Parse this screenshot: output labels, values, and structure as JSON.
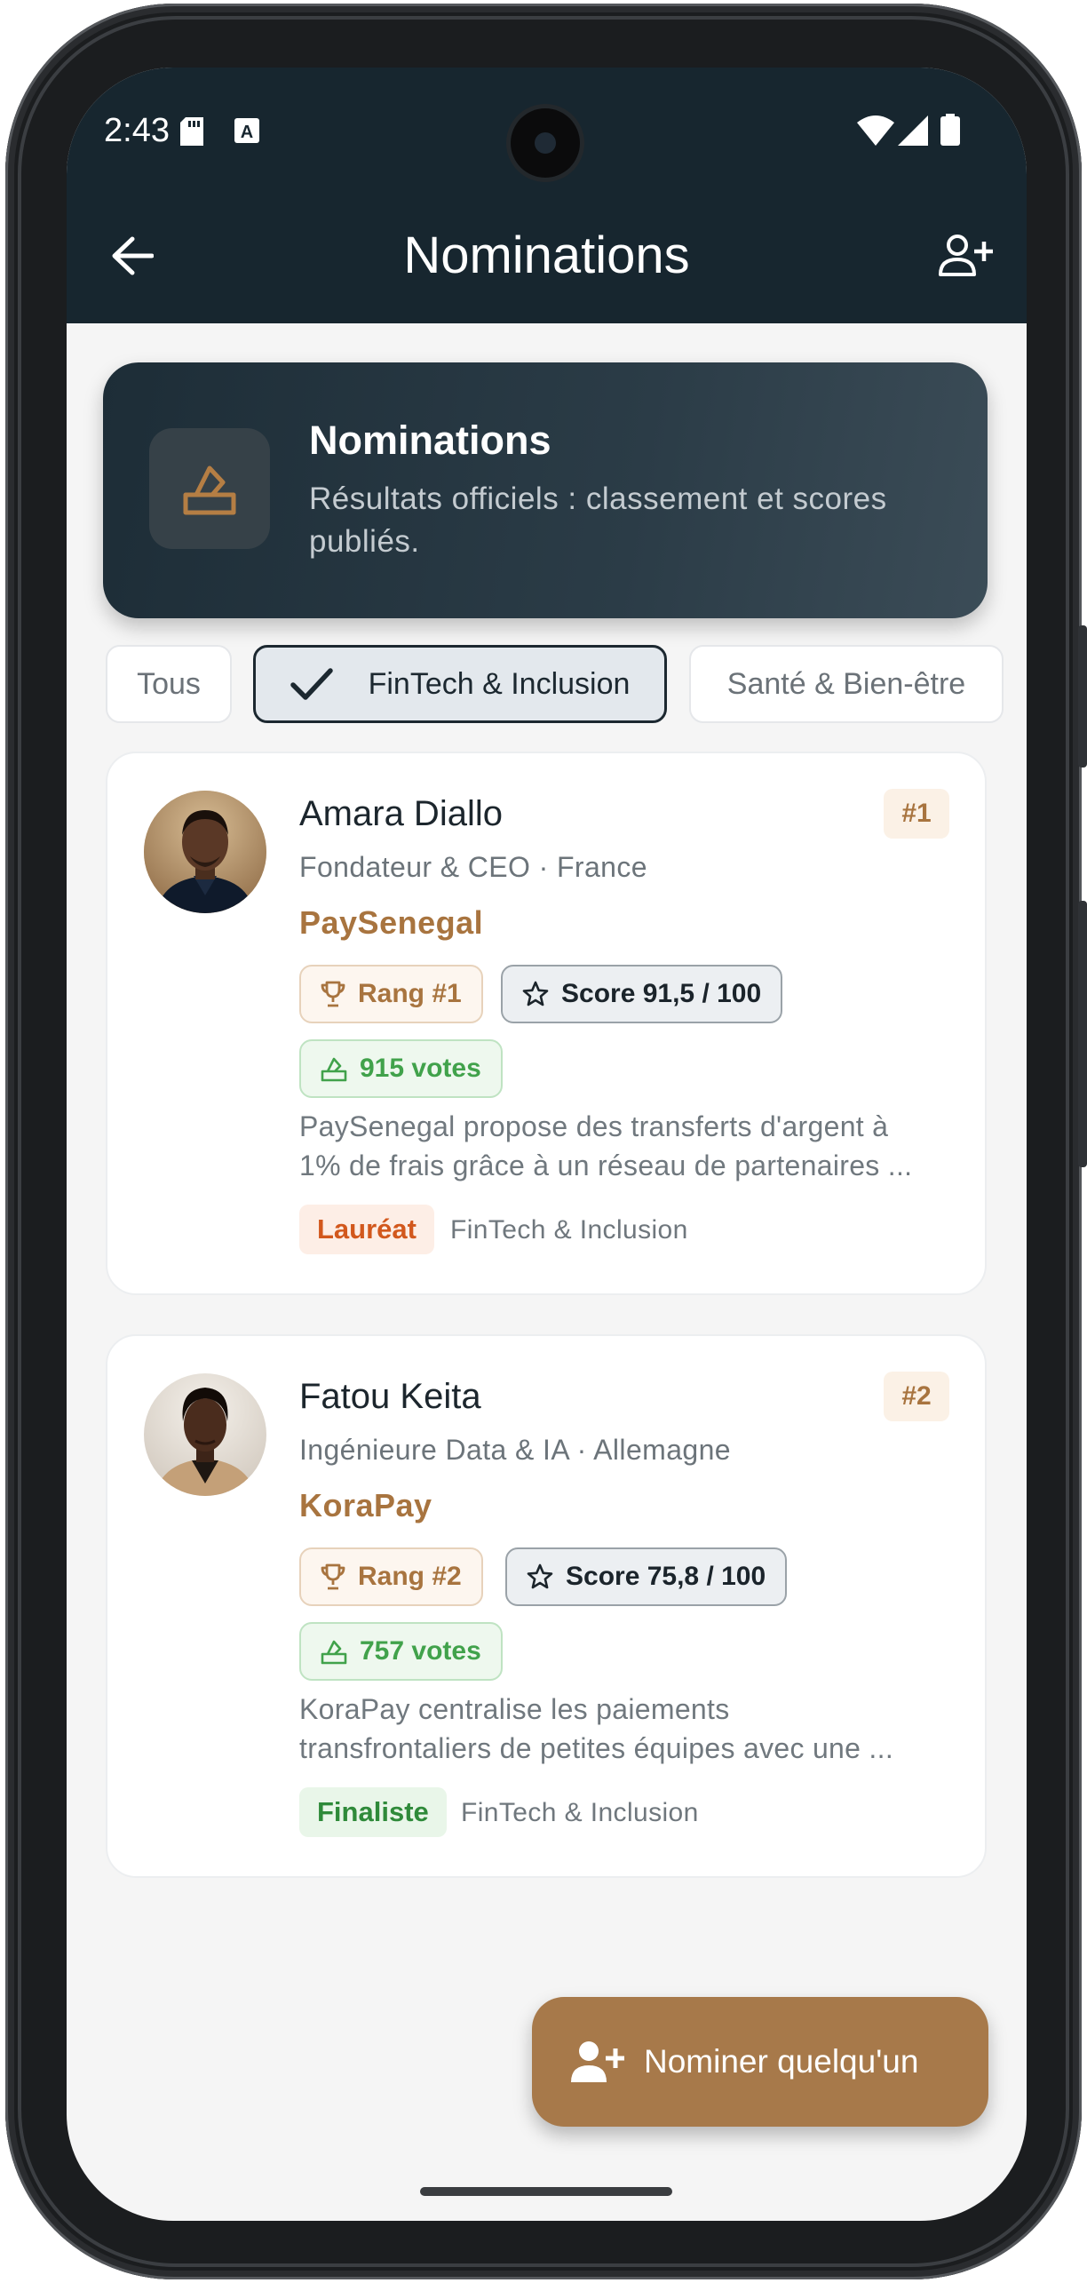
{
  "status_bar": {
    "time": "2:43",
    "icons": [
      "sd-card-icon",
      "keyboard-a-icon",
      "wifi-icon",
      "signal-icon",
      "battery-icon"
    ]
  },
  "app_bar": {
    "title": "Nominations",
    "back_icon": "arrow-left-icon",
    "action_icon": "add-person-icon"
  },
  "header_card": {
    "icon": "ballot-box-icon",
    "title": "Nominations",
    "subtitle": "Résultats officiels : classement et scores publiés."
  },
  "filters": {
    "items": [
      {
        "label": "Tous",
        "selected": false
      },
      {
        "label": "FinTech & Inclusion",
        "selected": true
      },
      {
        "label": "Santé & Bien-être",
        "selected": false
      }
    ]
  },
  "nominees": [
    {
      "name": "Amara Diallo",
      "role": "Fondateur & CEO · France",
      "company": "PaySenegal",
      "corner_rank": "#1",
      "rank_label": "Rang #1",
      "score_label": "Score 91,5 / 100",
      "votes_label": "915 votes",
      "description_line1": "PaySenegal propose des transferts d'argent à",
      "description_line2": "1% de frais grâce à un réseau de partenaires ...",
      "status": "Lauréat",
      "category": "FinTech & Inclusion"
    },
    {
      "name": "Fatou Keita",
      "role": "Ingénieure Data & IA · Allemagne",
      "company": "KoraPay",
      "corner_rank": "#2",
      "rank_label": "Rang #2",
      "score_label": "Score 75,8 / 100",
      "votes_label": "757 votes",
      "description_line1": "KoraPay centralise les paiements",
      "description_line2": "transfrontaliers de petites équipes avec une ...",
      "status": "Finaliste",
      "category": "FinTech & Inclusion"
    }
  ],
  "fab": {
    "label": "Nominer quelqu'un",
    "icon": "add-person-icon"
  },
  "colors": {
    "header_bg": "#17262f",
    "accent": "#a7794a",
    "winner": "#d2581d",
    "finalist": "#2f8a3a",
    "votes": "#41a24b"
  }
}
